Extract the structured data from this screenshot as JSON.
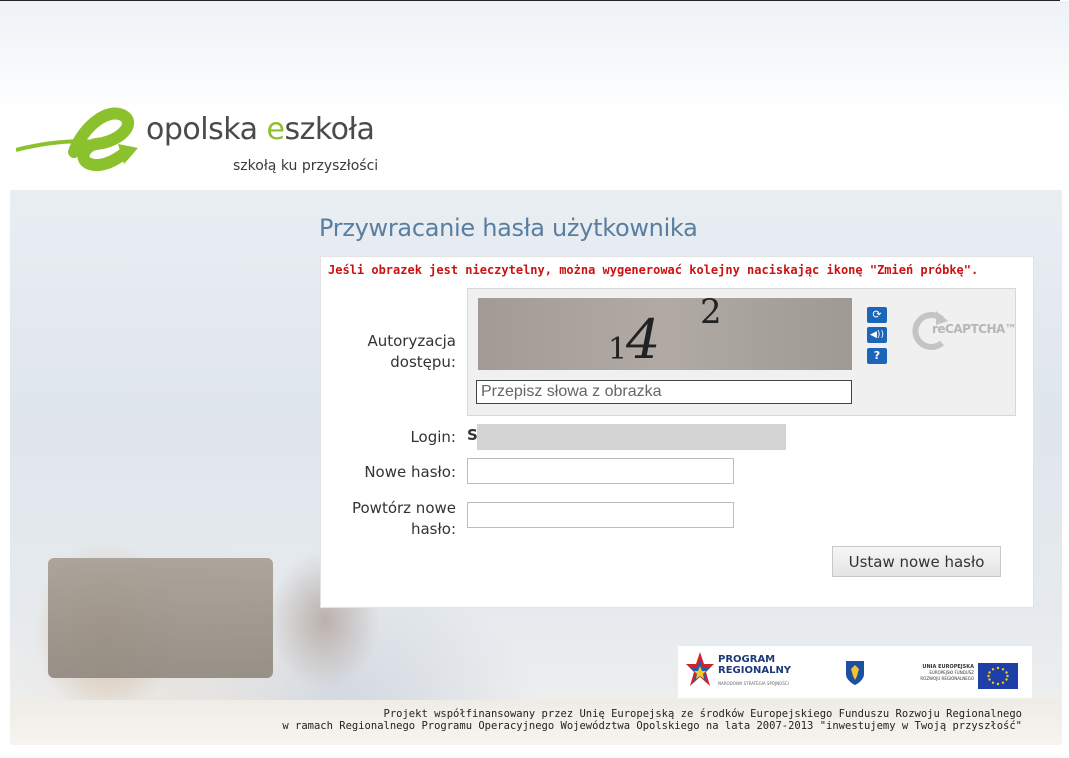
{
  "logo": {
    "name_prefix": "opolska ",
    "name_accent": "e",
    "name_suffix": "szkoła",
    "tagline": "szkołą ku przyszłości"
  },
  "page": {
    "title": "Przywracanie hasła użytkownika",
    "warning": "Jeśli obrazek jest nieczytelny, można wygenerować kolejny naciskając ikonę \"Zmień próbkę\"."
  },
  "captcha": {
    "label": "Autoryzacja dostępu:",
    "image_digit_1": "1",
    "image_digit_2": "4",
    "image_digit_3": "2",
    "input_placeholder": "Przepisz słowa z obrazka",
    "reload_icon": "reload-icon",
    "audio_icon": "audio-icon",
    "help_icon": "help-icon",
    "brand": "reCAPTCHA™"
  },
  "form": {
    "login_label": "Login:",
    "login_value": "S",
    "new_password_label": "Nowe hasło:",
    "repeat_password_label": "Powtórz nowe hasło:",
    "submit_label": "Ustaw nowe hasło"
  },
  "sponsors": {
    "program_line1": "PROGRAM",
    "program_line2": "REGIONALNY",
    "program_sub": "NARODOWA STRATEGIA SPÓJNOŚCI",
    "eu_title": "UNIA EUROPEJSKA",
    "eu_line2": "EUROPEJSKI FUNDUSZ",
    "eu_line3": "ROZWOJU REGIONALNEGO"
  },
  "footer": {
    "line1": "Projekt współfinansowany przez Unię Europejską ze środków Europejskiego Funduszu Rozwoju Regionalnego",
    "line2": "w ramach Regionalnego Programu Operacyjnego Województwa Opolskiego na lata 2007-2013 \"inwestujemy w Twoją przyszłość\""
  },
  "colors": {
    "brand_green": "#8cc12e",
    "title_blue": "#5a7ea0",
    "warning_red": "#cc1111",
    "recaptcha_blue": "#1c66b9"
  }
}
